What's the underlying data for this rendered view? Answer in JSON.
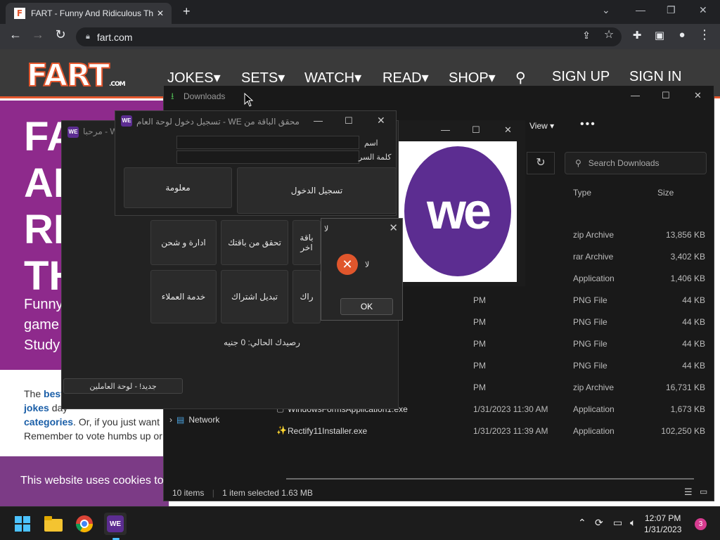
{
  "browser": {
    "tab_title": "FART - Funny And Ridiculous Thi",
    "tab_favicon": "F",
    "url": "fart.com",
    "new_tab": "+",
    "close_tab": "✕"
  },
  "website": {
    "logo": "FART",
    "logo_suffix": ".COM",
    "nav": [
      "JOKES▾",
      "SETS▾",
      "WATCH▾",
      "READ▾",
      "SHOP▾",
      "SIGN UP",
      "SIGN IN"
    ],
    "hero_lines": [
      "FA",
      "AI",
      "RI",
      "TH"
    ],
    "hero_sub": [
      "Funny",
      "game",
      "Study"
    ],
    "body": {
      "line1_prefix": "The ",
      "line1_link": "best",
      "line2_link": "jokes",
      "line2_rest": " day ",
      "line3_link": "categories",
      "line3_rest": ". Or, if you just want",
      "line4": "Remember to vote humbs up or"
    },
    "cookie": "This website uses cookies to"
  },
  "explorer": {
    "title": "Downloads",
    "view_label": "View ▾",
    "more": "•••",
    "search_placeholder": "Search Downloads",
    "columns": {
      "type": "Type",
      "size": "Size"
    },
    "rows": [
      {
        "name": "",
        "date": "PM",
        "type": "zip Archive",
        "size": "13,856 KB"
      },
      {
        "name": "",
        "date": "PM",
        "type": "rar Archive",
        "size": "3,402 KB"
      },
      {
        "name": "",
        "date": "PM",
        "type": "Application",
        "size": "1,406 KB"
      },
      {
        "name": "",
        "date": "PM",
        "type": "PNG File",
        "size": "44 KB"
      },
      {
        "name": "",
        "date": "PM",
        "type": "PNG File",
        "size": "44 KB"
      },
      {
        "name": "",
        "date": "PM",
        "type": "PNG File",
        "size": "44 KB"
      },
      {
        "name": "",
        "date": "PM",
        "type": "PNG File",
        "size": "44 KB"
      },
      {
        "name": "",
        "date": "PM",
        "type": "zip Archive",
        "size": "16,731 KB"
      },
      {
        "name": "WindowsFormsApplication1.exe",
        "date": "1/31/2023 11:30 AM",
        "type": "Application",
        "size": "1,673 KB"
      },
      {
        "name": "Rectify11Installer.exe",
        "date": "1/31/2023 11:39 AM",
        "type": "Application",
        "size": "102,250 KB"
      }
    ],
    "nav_network": "Network",
    "status_items": "10 items",
    "status_selected": "1 item selected  1.63 MB"
  },
  "image_viewer": {
    "logo_text": "we"
  },
  "app": {
    "title": "مرحبا - W",
    "logo": "WE",
    "buttons": {
      "manage": "ادارة و شحن",
      "check": "تحقق من باقتك",
      "package_partial": "باقة\nاخر",
      "customer_service": "خدمة العملاء",
      "change_sub": "تبديل اشتراك",
      "sub_partial": "راك"
    },
    "balance": "رصيدك الحالي: 0 جنيه",
    "employees": "جديد! - لوحة العاملين"
  },
  "login": {
    "title": "محقق الباقة من WE - تسجيل دخول لوحة العام...",
    "name_label": "اسم",
    "password_label": "كلمة السر",
    "info_button": "معلومة",
    "login_button": "تسجيل الدخول"
  },
  "msgbox": {
    "title": "لا",
    "message": "لا",
    "ok": "OK"
  },
  "taskbar": {
    "time": "12:07 PM",
    "date": "1/31/2023",
    "notifications": "3"
  },
  "colors": {
    "accent_orange": "#e4572e",
    "we_purple": "#5c2d91",
    "hero_purple": "#8e2a8c"
  }
}
